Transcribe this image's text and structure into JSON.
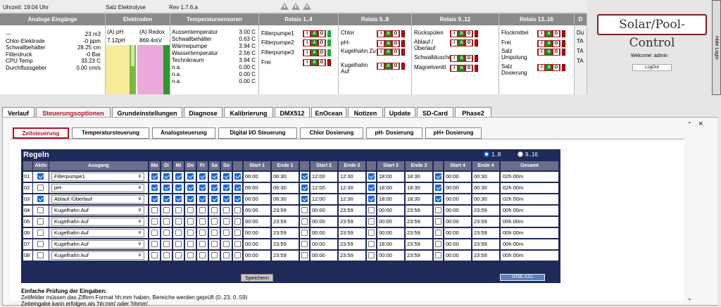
{
  "status": {
    "time": "Uhrzeit: 19:04 Uhr",
    "mode": "Salz Elektrolyse",
    "version": "Rev 1.7.6.a"
  },
  "headers": {
    "analog": "Analoge Eingänge",
    "electrodes": "Elektroden",
    "temp": "Temperatursensoren",
    "relais1": "Relais 1..4",
    "relais5": "Relais 5..8",
    "relais9": "Relais 9..12",
    "relais13": "Relais 13..16",
    "du": "D"
  },
  "analog": [
    {
      "label": "---",
      "value": "23 m3"
    },
    {
      "label": "Chlor-Elektrode",
      "value": "-0 ppm"
    },
    {
      "label": "Schwallbehälter",
      "value": "28.25 cm"
    },
    {
      "label": "Filterdruck",
      "value": "-0 Bar"
    },
    {
      "label": "CPU Temp",
      "value": "33.23 C"
    },
    {
      "label": "Durchflussgeber",
      "value": "0.00 cm/s"
    }
  ],
  "electrodes": {
    "ph_label": "(A) pH",
    "ph_value": "7.12pH",
    "redox_label": "(A) Redox",
    "redox_value": "869.4mV"
  },
  "temps": [
    {
      "label": "Aussentemperatur",
      "value": "3.00 C"
    },
    {
      "label": "Schwallbehälter",
      "value": "0.63 C"
    },
    {
      "label": "Wärmepumpe",
      "value": "3.94 C"
    },
    {
      "label": "Wassertemperatur",
      "value": "2.56 C"
    },
    {
      "label": "Technikraum",
      "value": "3.94 C"
    },
    {
      "label": "n.a.",
      "value": "0.00 C"
    },
    {
      "label": "n.a.",
      "value": "0.00 C"
    },
    {
      "label": "n.a.",
      "value": "0.00 C"
    }
  ],
  "relais": {
    "r1": [
      "Filterpumpe1",
      "Filterpumpe2",
      "Filterpumpe3",
      "Frei"
    ],
    "r5": [
      "Chlor",
      "pH-",
      "Kugelhahn Zu",
      "Kugelhahn Auf"
    ],
    "r9": [
      "Rückspülen",
      "Ablauf /Überlauf",
      "Schwalldusche",
      "Magnetventil"
    ],
    "r13": [
      "Flockmittel",
      "Frei",
      "Salz Umpolung",
      "Salz Dosierung"
    ],
    "r17": [
      "Du",
      "TA",
      "TA",
      "TA"
    ]
  },
  "iao": {
    "i": "I",
    "a": "A",
    "o": "O"
  },
  "logo": "Solar/Pool-Control",
  "welcome": "Welcome:  admin",
  "logout": "LogOut",
  "hide_login": "Hide Login",
  "tabs": [
    "Verlauf",
    "Steuerungsoptionen",
    "Grundeinstellungen",
    "Diagnose",
    "Kalibrierung",
    "DMX512",
    "EnOcean",
    "Notizen",
    "Update",
    "SD-Card",
    "Phase2"
  ],
  "subtabs": [
    "Zeitsteuerung",
    "Temperatursteuerung",
    "Analogsteuerung",
    "Digital I/O Steuerung",
    "Chlor Dosierung",
    "pH- Dosierung",
    "pH+ Dosierung"
  ],
  "grid": {
    "title": "Regeln",
    "radio1": "1..8",
    "radio2": "9..16",
    "cols": {
      "aktiv": "Aktiv",
      "ausgang": "Ausgang",
      "mo": "Mo",
      "di": "Di",
      "mi": "Mi",
      "do": "Do",
      "fr": "Fr",
      "sa": "Sa",
      "so": "So",
      "s1": "Start 1",
      "e1": "Ende 1",
      "s2": "Start 2",
      "e2": "Ende 2",
      "s3": "Start 3",
      "e3": "Ende 3",
      "s4": "Start 4",
      "e4": "Ende 4",
      "gesamt": "Gesamt"
    },
    "rows": [
      {
        "nr": "01",
        "aktiv": true,
        "ausgang": "Filterpumpe1",
        "days": [
          true,
          true,
          true,
          true,
          true,
          true,
          true
        ],
        "en": [
          true,
          true,
          true,
          true
        ],
        "t": [
          "06:00",
          "06:30",
          "12:00",
          "12:30",
          "18:00",
          "18:30",
          "00:00",
          "00:30"
        ],
        "gesamt": "02h 00m"
      },
      {
        "nr": "02",
        "aktiv": false,
        "ausgang": "pH-",
        "days": [
          true,
          true,
          true,
          true,
          true,
          true,
          true
        ],
        "en": [
          true,
          true,
          true,
          true
        ],
        "t": [
          "06:00",
          "06:30",
          "12:00",
          "12:30",
          "18:00",
          "18:30",
          "00:00",
          "00:30"
        ],
        "gesamt": "02h 00m"
      },
      {
        "nr": "03",
        "aktiv": true,
        "ausgang": "Ablauf /Überlauf",
        "days": [
          true,
          true,
          true,
          true,
          true,
          true,
          true
        ],
        "en": [
          true,
          true,
          true,
          true
        ],
        "t": [
          "06:00",
          "06:30",
          "12:00",
          "12:30",
          "18:00",
          "18:30",
          "00:00",
          "00:30"
        ],
        "gesamt": "02h 00m"
      },
      {
        "nr": "04",
        "aktiv": false,
        "ausgang": "Kugelhahn Auf",
        "days": [
          false,
          false,
          false,
          false,
          false,
          false,
          false
        ],
        "en": [
          false,
          false,
          false,
          false
        ],
        "t": [
          "00:00",
          "23:59",
          "00:00",
          "23:59",
          "00:00",
          "23:59",
          "00:00",
          "23:59"
        ],
        "gesamt": "00h 00m"
      },
      {
        "nr": "05",
        "aktiv": false,
        "ausgang": "Kugelhahn Auf",
        "days": [
          false,
          false,
          false,
          false,
          false,
          false,
          false
        ],
        "en": [
          false,
          false,
          false,
          false
        ],
        "t": [
          "00:00",
          "23:59",
          "00:00",
          "23:59",
          "00:00",
          "23:59",
          "00:00",
          "23:59"
        ],
        "gesamt": "00h 00m"
      },
      {
        "nr": "06",
        "aktiv": false,
        "ausgang": "Kugelhahn Auf",
        "days": [
          false,
          false,
          false,
          false,
          false,
          false,
          false
        ],
        "en": [
          false,
          false,
          false,
          false
        ],
        "t": [
          "00:00",
          "23:59",
          "00:00",
          "23:59",
          "00:00",
          "23:59",
          "00:00",
          "23:59"
        ],
        "gesamt": "00h 00m"
      },
      {
        "nr": "07",
        "aktiv": false,
        "ausgang": "Kugelhahn Auf",
        "days": [
          false,
          false,
          false,
          false,
          false,
          false,
          false
        ],
        "en": [
          false,
          false,
          false,
          false
        ],
        "t": [
          "00:00",
          "23:59",
          "00:00",
          "23:59",
          "18:00",
          "23:59",
          "00:00",
          "23:59"
        ],
        "gesamt": "00h 00m"
      },
      {
        "nr": "08",
        "aktiv": false,
        "ausgang": "Kugelhahn Auf",
        "days": [
          false,
          false,
          false,
          false,
          false,
          false,
          false
        ],
        "en": [
          false,
          false,
          false,
          false
        ],
        "t": [
          "00:00",
          "23:59",
          "00:00",
          "23:59",
          "00:00",
          "23:59",
          "00:00",
          "23:59"
        ],
        "gesamt": "00h 00m"
      }
    ],
    "save": "Speichern",
    "badge": "HTML 4.01"
  },
  "help": {
    "title": "Einfache Prüfung der Eingaben:",
    "line1": "Zeitfelder müssen das Ziffern Format hh:mm haben, Bereiche werden geprüft (0..23, 0..59)",
    "line2": "Zeiteingabe kann erfolgen als 'hh:mm' oder 'hhmm'."
  }
}
